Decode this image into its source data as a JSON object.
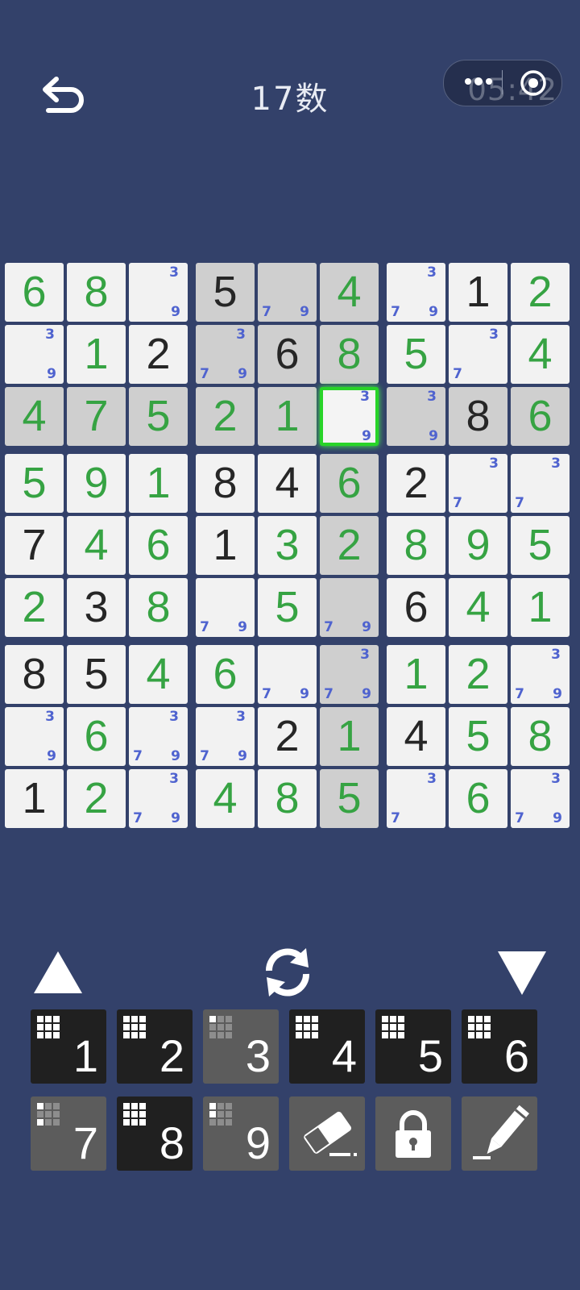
{
  "header": {
    "title": "17数",
    "timer": "05:42"
  },
  "board": {
    "rows": [
      [
        {
          "v": "6",
          "t": "u"
        },
        {
          "v": "8",
          "t": "u"
        },
        {
          "n": [
            "3",
            "9"
          ]
        },
        {
          "v": "5",
          "t": "g",
          "h": true
        },
        {
          "n": [
            "7",
            "9"
          ],
          "h": true
        },
        {
          "v": "4",
          "t": "u",
          "h": true
        },
        {
          "n": [
            "3",
            "7",
            "9"
          ]
        },
        {
          "v": "1",
          "t": "g"
        },
        {
          "v": "2",
          "t": "u"
        }
      ],
      [
        {
          "n": [
            "3",
            "9"
          ]
        },
        {
          "v": "1",
          "t": "u"
        },
        {
          "v": "2",
          "t": "g"
        },
        {
          "n": [
            "3",
            "7",
            "9"
          ],
          "h": true
        },
        {
          "v": "6",
          "t": "g",
          "h": true
        },
        {
          "v": "8",
          "t": "u",
          "h": true
        },
        {
          "v": "5",
          "t": "u"
        },
        {
          "n": [
            "3",
            "7"
          ]
        },
        {
          "v": "4",
          "t": "u"
        }
      ],
      [
        {
          "v": "4",
          "t": "u",
          "h": true
        },
        {
          "v": "7",
          "t": "u",
          "h": true
        },
        {
          "v": "5",
          "t": "u",
          "h": true
        },
        {
          "v": "2",
          "t": "u",
          "h": true
        },
        {
          "v": "1",
          "t": "u",
          "h": true
        },
        {
          "n": [
            "3",
            "9"
          ],
          "sel": true
        },
        {
          "n": [
            "3",
            "9"
          ],
          "h": true
        },
        {
          "v": "8",
          "t": "g",
          "h": true
        },
        {
          "v": "6",
          "t": "u",
          "h": true
        }
      ],
      [
        {
          "v": "5",
          "t": "u"
        },
        {
          "v": "9",
          "t": "u"
        },
        {
          "v": "1",
          "t": "u"
        },
        {
          "v": "8",
          "t": "g"
        },
        {
          "v": "4",
          "t": "g"
        },
        {
          "v": "6",
          "t": "u",
          "h": true
        },
        {
          "v": "2",
          "t": "g"
        },
        {
          "n": [
            "3",
            "7"
          ]
        },
        {
          "n": [
            "3",
            "7"
          ]
        }
      ],
      [
        {
          "v": "7",
          "t": "g"
        },
        {
          "v": "4",
          "t": "u"
        },
        {
          "v": "6",
          "t": "u"
        },
        {
          "v": "1",
          "t": "g"
        },
        {
          "v": "3",
          "t": "u"
        },
        {
          "v": "2",
          "t": "u",
          "h": true
        },
        {
          "v": "8",
          "t": "u"
        },
        {
          "v": "9",
          "t": "u"
        },
        {
          "v": "5",
          "t": "u"
        }
      ],
      [
        {
          "v": "2",
          "t": "u"
        },
        {
          "v": "3",
          "t": "g"
        },
        {
          "v": "8",
          "t": "u"
        },
        {
          "n": [
            "7",
            "9"
          ]
        },
        {
          "v": "5",
          "t": "u"
        },
        {
          "n": [
            "7",
            "9"
          ],
          "h": true
        },
        {
          "v": "6",
          "t": "g"
        },
        {
          "v": "4",
          "t": "u"
        },
        {
          "v": "1",
          "t": "u"
        }
      ],
      [
        {
          "v": "8",
          "t": "g"
        },
        {
          "v": "5",
          "t": "g"
        },
        {
          "v": "4",
          "t": "u"
        },
        {
          "v": "6",
          "t": "u"
        },
        {
          "n": [
            "7",
            "9"
          ]
        },
        {
          "n": [
            "3",
            "7",
            "9"
          ],
          "h": true
        },
        {
          "v": "1",
          "t": "u"
        },
        {
          "v": "2",
          "t": "u"
        },
        {
          "n": [
            "3",
            "7",
            "9"
          ]
        }
      ],
      [
        {
          "n": [
            "3",
            "9"
          ]
        },
        {
          "v": "6",
          "t": "u"
        },
        {
          "n": [
            "3",
            "7",
            "9"
          ]
        },
        {
          "n": [
            "3",
            "7",
            "9"
          ]
        },
        {
          "v": "2",
          "t": "g"
        },
        {
          "v": "1",
          "t": "u",
          "h": true
        },
        {
          "v": "4",
          "t": "g"
        },
        {
          "v": "5",
          "t": "u"
        },
        {
          "v": "8",
          "t": "u"
        }
      ],
      [
        {
          "v": "1",
          "t": "g"
        },
        {
          "v": "2",
          "t": "u"
        },
        {
          "n": [
            "3",
            "7",
            "9"
          ]
        },
        {
          "v": "4",
          "t": "u"
        },
        {
          "v": "8",
          "t": "u"
        },
        {
          "v": "5",
          "t": "u",
          "h": true
        },
        {
          "n": [
            "3",
            "7"
          ]
        },
        {
          "v": "6",
          "t": "u"
        },
        {
          "n": [
            "3",
            "7",
            "9"
          ]
        }
      ]
    ]
  },
  "keypad": [
    {
      "label": "1",
      "style": "dark",
      "mini": "full"
    },
    {
      "label": "2",
      "style": "dark",
      "mini": "full"
    },
    {
      "label": "3",
      "style": "light",
      "mini": "partial3"
    },
    {
      "label": "4",
      "style": "dark",
      "mini": "full"
    },
    {
      "label": "5",
      "style": "dark",
      "mini": "full"
    },
    {
      "label": "6",
      "style": "dark",
      "mini": "full"
    },
    {
      "label": "7",
      "style": "light",
      "mini": "partial7"
    },
    {
      "label": "8",
      "style": "dark",
      "mini": "full"
    },
    {
      "label": "9",
      "style": "light",
      "mini": "partial9"
    },
    {
      "label": "",
      "style": "light",
      "icon": "eraser-icon"
    },
    {
      "label": "",
      "style": "light",
      "icon": "lock-icon"
    },
    {
      "label": "",
      "style": "light",
      "icon": "pencil-icon"
    }
  ],
  "colors": {
    "background": "#33416a",
    "userDigit": "#36a343",
    "givenDigit": "#262626",
    "note": "#4f63cf",
    "selected": "#28d428"
  }
}
